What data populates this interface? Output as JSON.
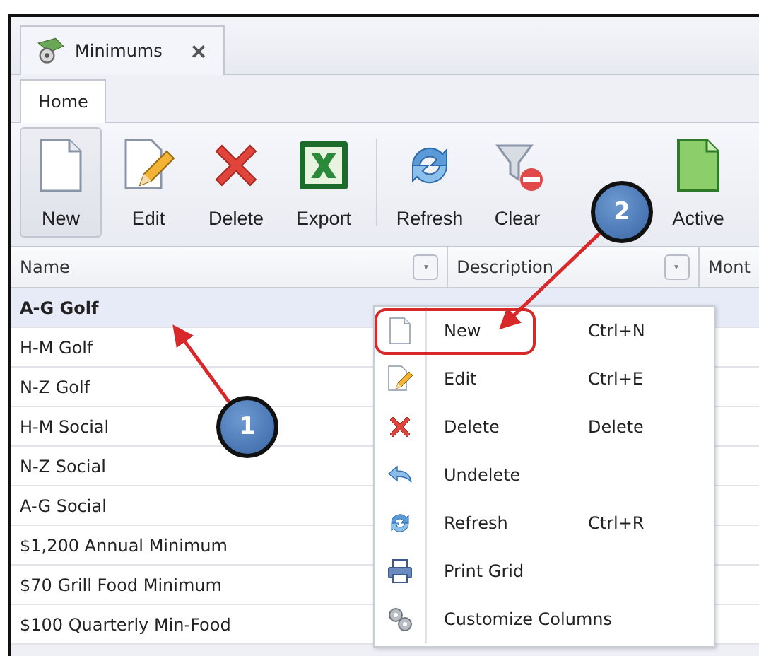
{
  "document_tab": {
    "title": "Minimums",
    "closable": true
  },
  "ribbon_tabs": [
    {
      "label": "Home",
      "selected": true
    }
  ],
  "toolbar": [
    {
      "label": "New",
      "kind": "page",
      "selected": true
    },
    {
      "label": "Edit",
      "kind": "edit",
      "selected": false
    },
    {
      "label": "Delete",
      "kind": "delete",
      "selected": false
    },
    {
      "label": "Export",
      "kind": "excel",
      "selected": false
    },
    {
      "label": "Refresh",
      "kind": "refresh",
      "selected": false,
      "separator_before": true
    },
    {
      "label": "Clear",
      "kind": "filter",
      "selected": false
    },
    {
      "label": "Active",
      "kind": "green-page",
      "selected": false
    }
  ],
  "table": {
    "columns": [
      {
        "label": "Name",
        "dropdown": true
      },
      {
        "label": "Description",
        "dropdown": true
      },
      {
        "label": "Mont",
        "dropdown": false
      }
    ],
    "rows": [
      {
        "name": "A-G Golf",
        "selected": true
      },
      {
        "name": "H-M Golf",
        "selected": false
      },
      {
        "name": "N-Z Golf",
        "selected": false
      },
      {
        "name": "H-M Social",
        "selected": false
      },
      {
        "name": "N-Z Social",
        "selected": false
      },
      {
        "name": "A-G Social",
        "selected": false
      },
      {
        "name": "$1,200 Annual Minimum",
        "selected": false
      },
      {
        "name": "$70 Grill Food Minimum",
        "selected": false
      },
      {
        "name": "$100 Quarterly Min-Food",
        "selected": false
      }
    ]
  },
  "context_menu": [
    {
      "label": "New",
      "shortcut": "Ctrl+N",
      "kind": "page",
      "highlighted": true
    },
    {
      "label": "Edit",
      "shortcut": "Ctrl+E",
      "kind": "edit",
      "highlighted": false
    },
    {
      "label": "Delete",
      "shortcut": "Delete",
      "kind": "delete",
      "highlighted": false
    },
    {
      "label": "Undelete",
      "kind": "undo",
      "highlighted": false
    },
    {
      "label": "Refresh",
      "shortcut": "Ctrl+R",
      "kind": "refresh",
      "highlighted": false
    },
    {
      "label": "Print Grid",
      "kind": "printer",
      "highlighted": false
    },
    {
      "label": "Customize Columns",
      "kind": "gears",
      "highlighted": false
    }
  ],
  "callouts": [
    {
      "number": "1"
    },
    {
      "number": "2"
    }
  ]
}
